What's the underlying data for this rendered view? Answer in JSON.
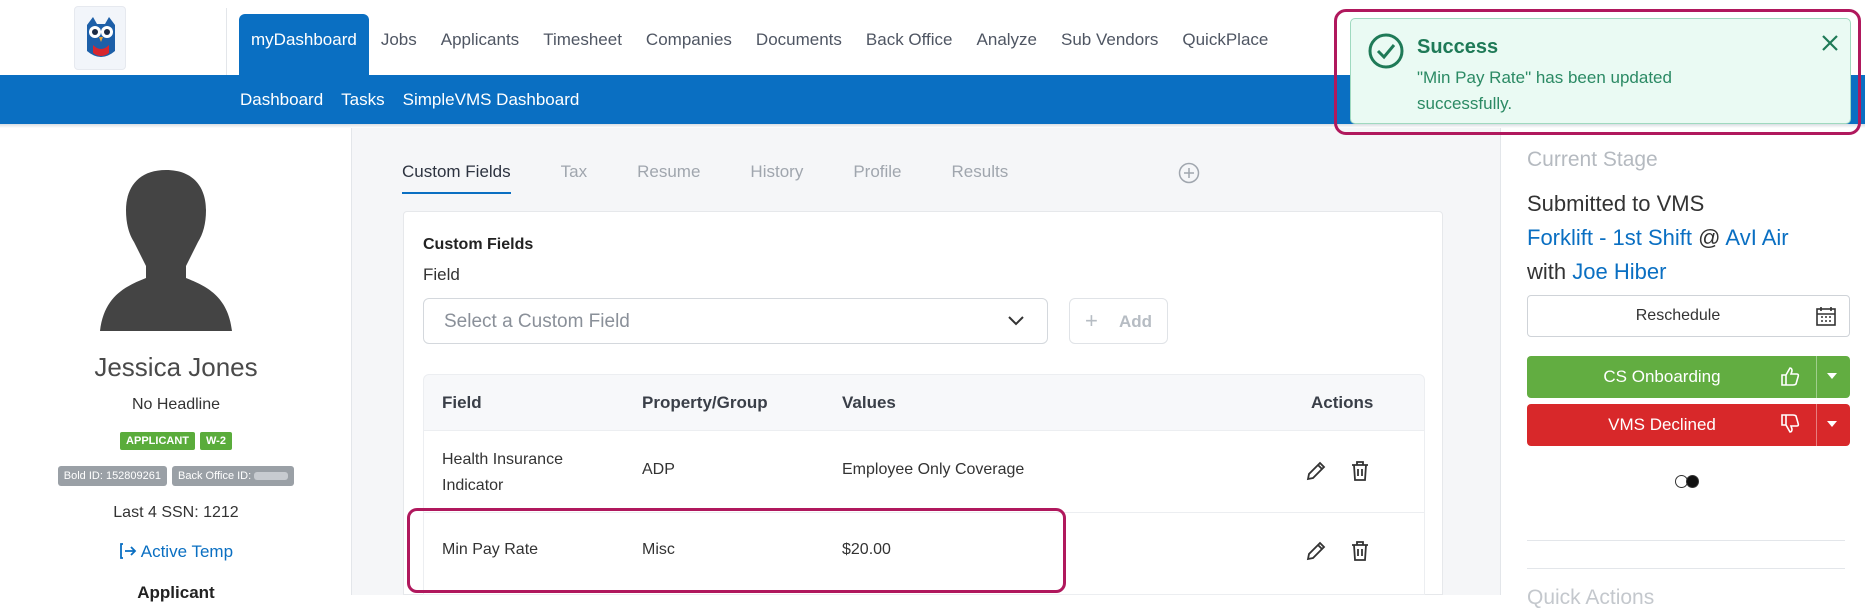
{
  "nav": {
    "items": [
      "myDashboard",
      "Jobs",
      "Applicants",
      "Timesheet",
      "Companies",
      "Documents",
      "Back Office",
      "Analyze",
      "Sub Vendors",
      "QuickPlace"
    ],
    "active": "myDashboard"
  },
  "subnav": {
    "items": [
      "Dashboard",
      "Tasks",
      "SimpleVMS Dashboard"
    ]
  },
  "profile": {
    "name": "Jessica Jones",
    "headline": "No Headline",
    "badges": [
      "APPLICANT",
      "W-2"
    ],
    "bold_id": "Bold ID: 152809261",
    "back_office_id": "Back Office ID:",
    "ssn": "Last 4 SSN: 1212",
    "status": "Active Temp",
    "applicant_label": "Applicant"
  },
  "tabs": [
    "Custom Fields",
    "Tax",
    "Resume",
    "History",
    "Profile",
    "Results"
  ],
  "custom_fields": {
    "title": "Custom Fields",
    "field_label": "Field",
    "select_placeholder": "Select a Custom Field",
    "add_label": "Add",
    "columns": [
      "Field",
      "Property/Group",
      "Values",
      "Actions"
    ],
    "rows": [
      {
        "field": "Health Insurance Indicator",
        "group": "ADP",
        "value": "Employee Only Coverage"
      },
      {
        "field": "Min Pay Rate",
        "group": "Misc",
        "value": "$20.00"
      }
    ]
  },
  "stage": {
    "title": "Current Stage",
    "status": "Submitted to VMS",
    "job": "Forklift - 1st Shift",
    "at": "@",
    "company": "AvI Air",
    "with": "with",
    "contact": "Joe Hiber",
    "reschedule": "Reschedule",
    "btn_onboarding": "CS Onboarding",
    "btn_declined": "VMS Declined",
    "onboarding_color": "#62ad41",
    "declined_color": "#d8282a",
    "quick_actions": "Quick Actions"
  },
  "toast": {
    "title": "Success",
    "message": "\"Min Pay Rate\" has been updated successfully."
  },
  "colors": {
    "brand_blue": "#0a6fc2",
    "highlight": "#b0185d"
  }
}
